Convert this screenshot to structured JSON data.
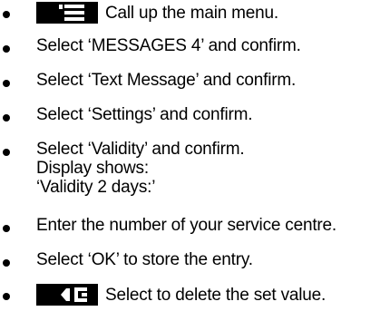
{
  "steps": [
    {
      "icon": "main-menu-key-icon",
      "text": "Call up the main menu."
    },
    {
      "text": "Select ‘MESSAGES 4’ and confirm."
    },
    {
      "text": "Select ‘Text Message’ and confirm."
    },
    {
      "text": "Select ‘Settings’ and confirm."
    },
    {
      "lines": [
        "Select ‘Validity’ and confirm.",
        "Display shows:",
        "‘Validity 2 days:’"
      ]
    },
    {
      "text": "Enter the number of your service centre."
    },
    {
      "text": "Select ‘OK’ to store the entry."
    },
    {
      "icon": "delete-key-icon",
      "text": "Select to delete the set value."
    }
  ]
}
